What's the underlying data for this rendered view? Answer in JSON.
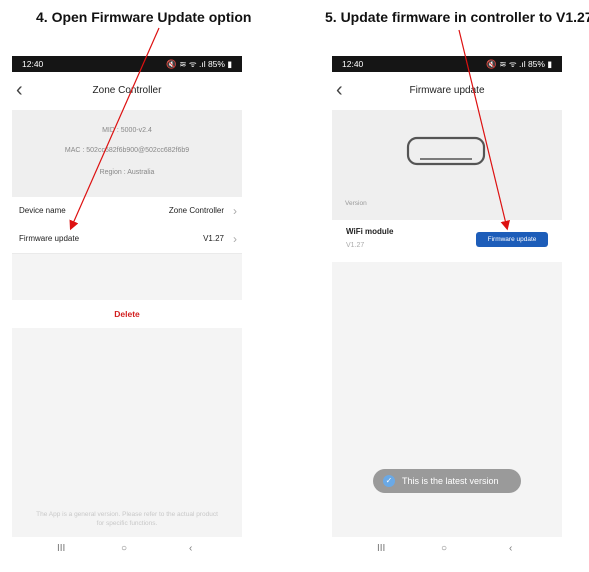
{
  "steps": {
    "step4": "4.   Open Firmware Update option",
    "step5": "5.   Update firmware in controller to V1.27"
  },
  "phone1": {
    "status": {
      "time": "12:40",
      "icons": "🔇 ≋ ᯤ .ıl 85% ▮"
    },
    "header": {
      "back": "‹",
      "title": "Zone Controller"
    },
    "info": {
      "mid": "MID : 5000-v2.4",
      "mac": "MAC : 502cc682f6b900@502cc682f6b9",
      "region": "Region : Australia"
    },
    "rows": [
      {
        "label": "Device name",
        "value": "Zone Controller",
        "chevron": "›"
      },
      {
        "label": "Firmware update",
        "value": "V1.27",
        "chevron": "›"
      }
    ],
    "delete_label": "Delete",
    "footer_note": [
      "The App is a general version. Please refer to the actual product",
      "for specific functions."
    ],
    "nav": {
      "recent": "III",
      "home": "○",
      "back": "‹"
    }
  },
  "phone2": {
    "status": {
      "time": "12:40",
      "icons": "🔇 ≋ ᯤ .ıl 85% ▮"
    },
    "header": {
      "back": "‹",
      "title": "Firmware update"
    },
    "version_label": "Version",
    "module": {
      "name": "WiFi module",
      "version": "V1.27",
      "button": "Firmware update"
    },
    "toast": {
      "icon": "✓",
      "text": "This is the latest version"
    },
    "nav": {
      "recent": "III",
      "home": "○",
      "back": "‹"
    }
  },
  "colors": {
    "annotation_arrow": "#dd1111",
    "button": "#1d5db9",
    "delete": "#d21f1f"
  }
}
